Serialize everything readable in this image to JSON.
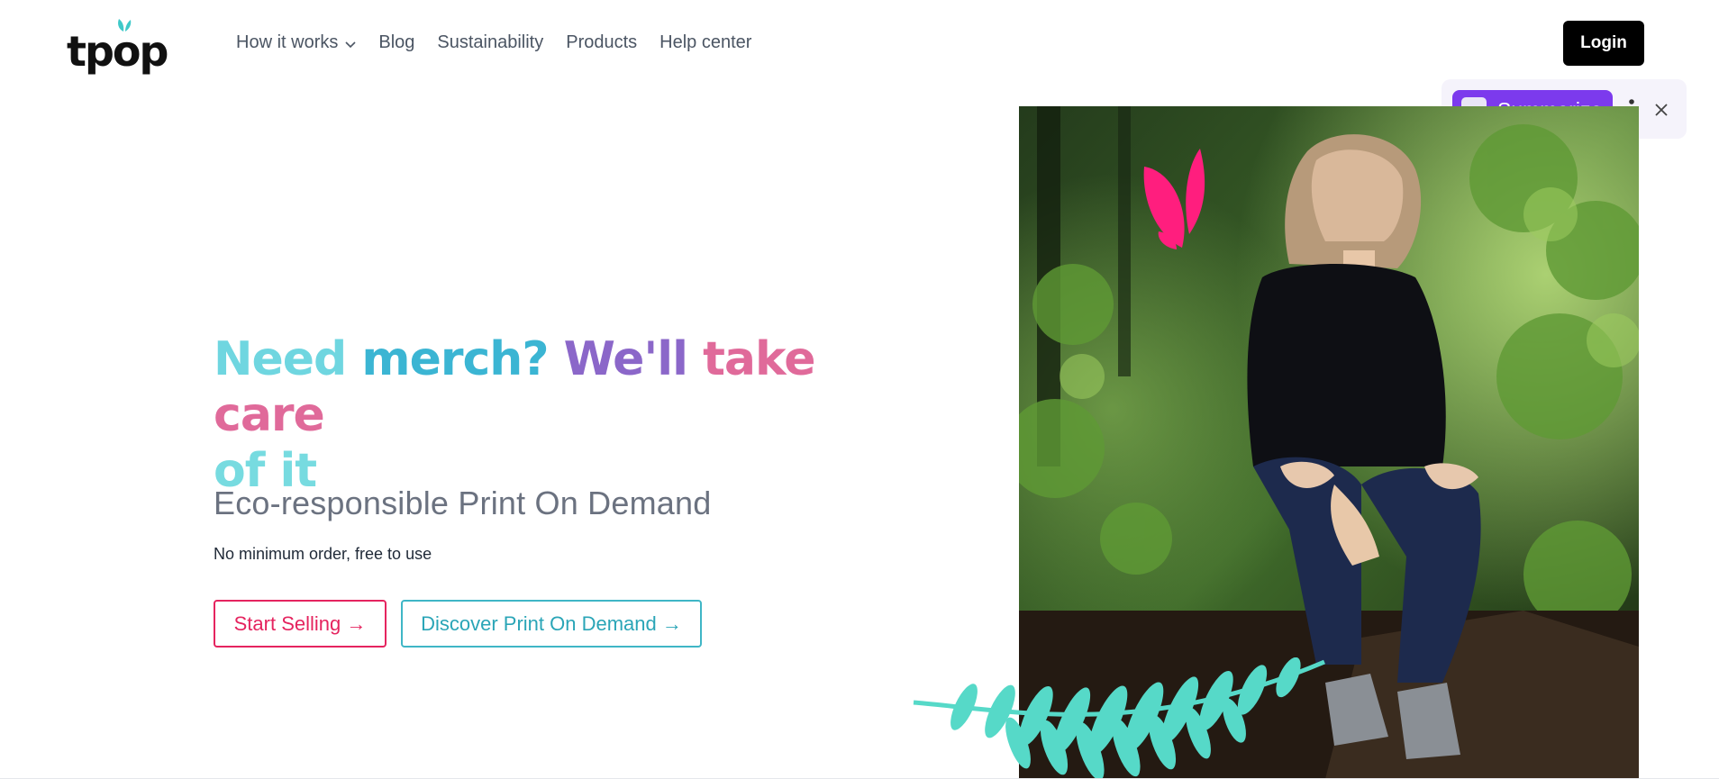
{
  "header": {
    "logo_text": "tpop",
    "nav": [
      {
        "label": "How it works",
        "has_dropdown": true
      },
      {
        "label": "Blog"
      },
      {
        "label": "Sustainability"
      },
      {
        "label": "Products"
      },
      {
        "label": "Help center"
      }
    ],
    "login_label": "Login"
  },
  "summarize_widget": {
    "label": "Summarize",
    "icons": [
      "summarize-app-icon",
      "more-vertical-icon",
      "close-icon"
    ]
  },
  "hero": {
    "title_parts": [
      "Need ",
      "merch? ",
      "We'll ",
      "take care",
      "of it"
    ],
    "subtitle": "Eco-responsible Print On Demand",
    "tagline": "No minimum order, free to use",
    "start_selling_label": "Start Selling →",
    "discover_label": "Discover Print On Demand →"
  },
  "colors": {
    "accent_pink": "#e5245f",
    "accent_teal": "#3fb6c6",
    "summarize_purple": "#7c3aed",
    "login_bg": "#000000"
  }
}
